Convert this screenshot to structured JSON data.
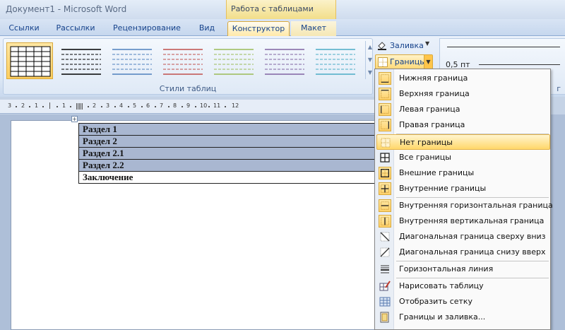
{
  "app": {
    "title": "Документ1 - Microsoft Word",
    "context_group": "Работа с таблицами"
  },
  "tabs": [
    "Ссылки",
    "Рассылки",
    "Рецензирование",
    "Вид",
    "Конструктор",
    "Макет"
  ],
  "active_tab": "Конструктор",
  "ribbon": {
    "styles_group_label": "Стили таблиц",
    "table_style_colors": [
      "#000000",
      "#000000",
      "#4f81bd",
      "#c0504d",
      "#9bbb59",
      "#8064a2",
      "#4bacc6"
    ],
    "selected_style_index": 0,
    "shading_label": "Заливка",
    "borders_label": "Границы",
    "pen_weight": "0,5 пт",
    "group_draw_label": "г"
  },
  "ruler": {
    "numbers": [
      "3",
      "2",
      "1",
      "1",
      "2",
      "3",
      "4",
      "5",
      "6",
      "7",
      "8",
      "9",
      "10",
      "11",
      "12"
    ]
  },
  "document": {
    "table_rows": [
      "Раздел 1",
      "Раздел 2",
      "Раздел 2.1",
      "Раздел 2.2",
      "Заключение"
    ]
  },
  "borders_menu": {
    "items": [
      {
        "label": "Нижняя граница",
        "icon": "border-bottom-icon"
      },
      {
        "label": "Верхняя граница",
        "icon": "border-top-icon"
      },
      {
        "label": "Левая граница",
        "icon": "border-left-icon"
      },
      {
        "label": "Правая граница",
        "icon": "border-right-icon"
      },
      {
        "label": "Нет границы",
        "icon": "no-border-icon"
      },
      {
        "label": "Все границы",
        "icon": "all-borders-icon"
      },
      {
        "label": "Внешние границы",
        "icon": "outside-borders-icon"
      },
      {
        "label": "Внутренние границы",
        "icon": "inside-borders-icon"
      },
      {
        "label": "Внутренняя горизонтальная граница",
        "icon": "inside-horizontal-border-icon"
      },
      {
        "label": "Внутренняя вертикальная граница",
        "icon": "inside-vertical-border-icon"
      },
      {
        "label": "Диагональная граница сверху вниз",
        "icon": "diagonal-down-border-icon"
      },
      {
        "label": "Диагональная граница снизу вверх",
        "icon": "diagonal-up-border-icon"
      },
      {
        "label": "Горизонтальная линия",
        "icon": "horizontal-line-icon"
      },
      {
        "label": "Нарисовать таблицу",
        "icon": "draw-table-icon"
      },
      {
        "label": "Отобразить сетку",
        "icon": "view-gridlines-icon"
      },
      {
        "label": "Границы и заливка...",
        "icon": "borders-and-shading-icon"
      }
    ],
    "highlighted_index": 4
  }
}
